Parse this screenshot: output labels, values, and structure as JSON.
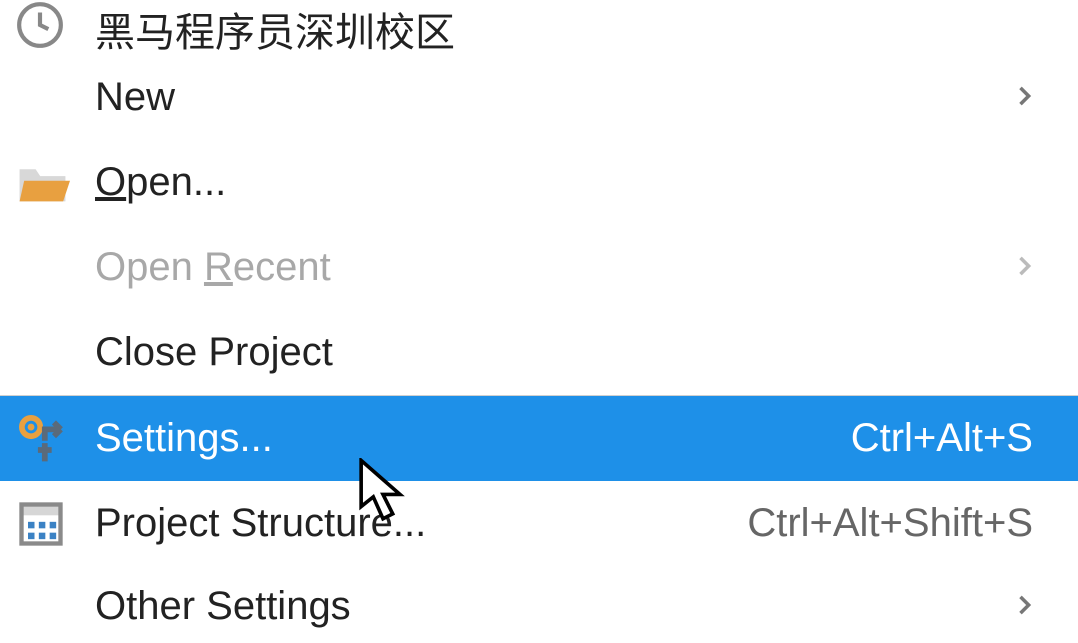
{
  "menu": {
    "items": [
      {
        "label": "黑马程序员深圳校区",
        "icon": "clock-icon"
      },
      {
        "label": "New",
        "submenu": true
      },
      {
        "label_pre": "",
        "mnemonic": "O",
        "label_post": "pen...",
        "icon": "folder-open-icon"
      },
      {
        "label_pre": "Open ",
        "mnemonic": "R",
        "label_post": "ecent",
        "submenu": true,
        "disabled": true
      },
      {
        "label": "Close Project"
      },
      {
        "separator": true
      },
      {
        "label": "Settings...",
        "icon": "settings-icon",
        "shortcut": "Ctrl+Alt+S",
        "selected": true
      },
      {
        "label": "Project Structure...",
        "icon": "project-structure-icon",
        "shortcut": "Ctrl+Alt+Shift+S"
      },
      {
        "label": "Other Settings",
        "submenu": true
      }
    ]
  }
}
